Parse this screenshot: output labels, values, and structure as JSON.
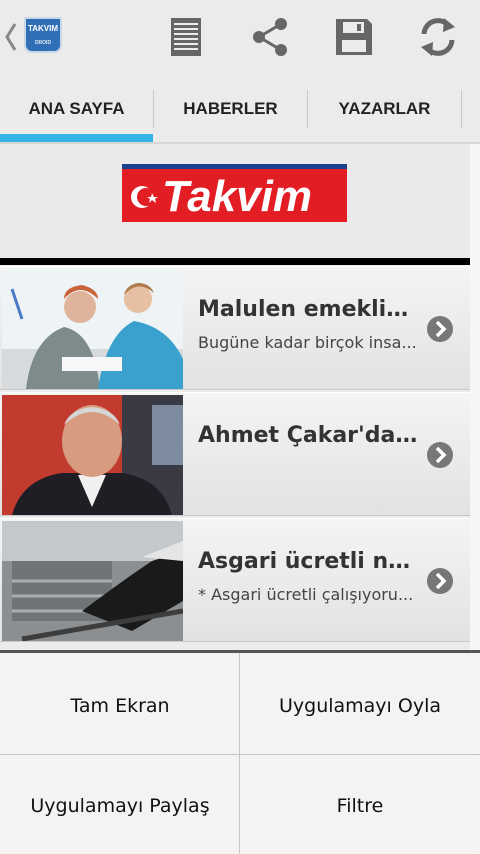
{
  "actionbar": {
    "logo_line1": "TAKVIM",
    "logo_line2": "DROID",
    "icons": [
      "back-chevron-icon",
      "app-logo",
      "list-icon",
      "share-icon",
      "save-icon",
      "refresh-icon"
    ]
  },
  "tabs": [
    {
      "label": "ANA SAYFA",
      "selected": true
    },
    {
      "label": "HABERLER",
      "selected": false
    },
    {
      "label": "YAZARLAR",
      "selected": false
    }
  ],
  "banner": {
    "logo_text": "Takvim"
  },
  "news": [
    {
      "title": "Malulen emekliy...",
      "subtitle": "Bugüne kadar birçok insa..."
    },
    {
      "title": "Ahmet Çakar'dan...",
      "subtitle": ""
    },
    {
      "title": "Asgari ücretli ne ...",
      "subtitle": "* Asgari ücretli çalışıyoru..."
    }
  ],
  "menu": {
    "items": [
      "Tam Ekran",
      "Uygulamayı Oyla",
      "Uygulamayı Paylaş",
      "Filtre"
    ]
  },
  "colors": {
    "accent": "#33b5e5",
    "brand_red": "#e31d24",
    "icon_gray": "#666666"
  }
}
